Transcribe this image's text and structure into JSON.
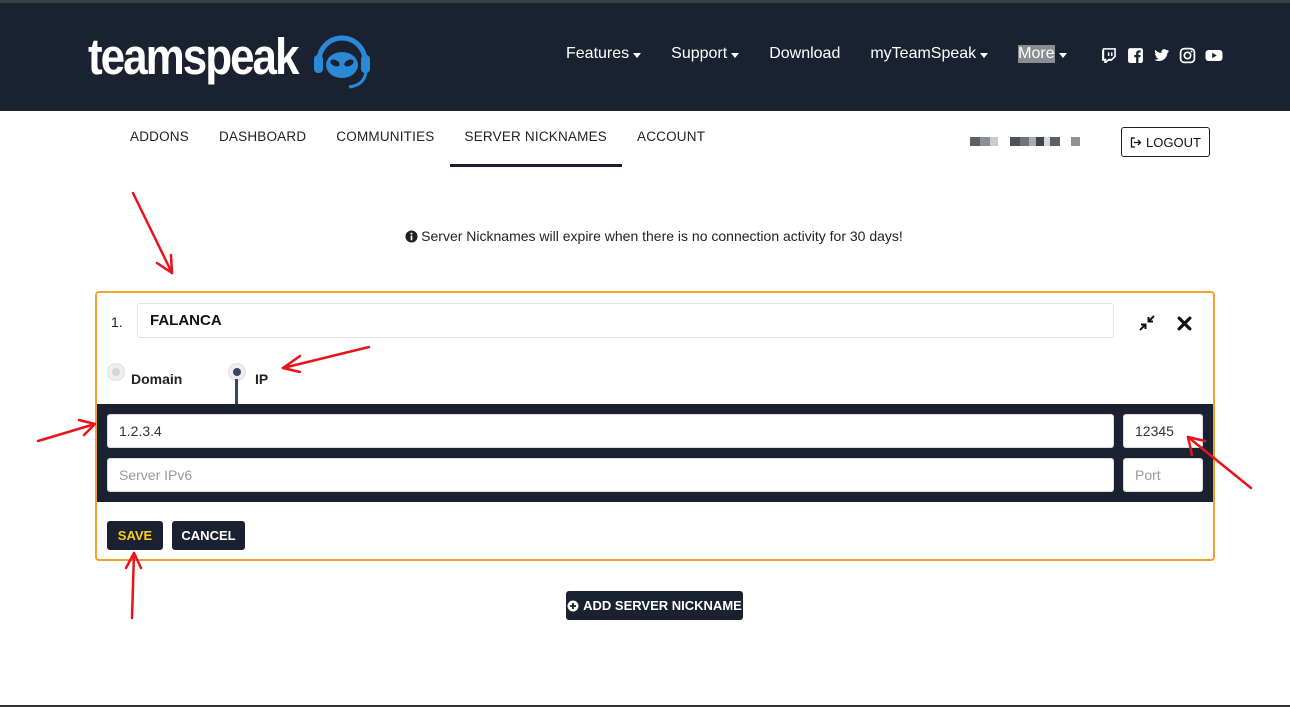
{
  "header": {
    "logo_text": "teamspeak",
    "nav": [
      {
        "label": "Features",
        "dropdown": true
      },
      {
        "label": "Support",
        "dropdown": true
      },
      {
        "label": "Download",
        "dropdown": false
      },
      {
        "label": "myTeamSpeak",
        "dropdown": true
      },
      {
        "label": "More",
        "dropdown": true
      }
    ],
    "social_icons": [
      "twitch-icon",
      "facebook-icon",
      "twitter-icon",
      "instagram-icon",
      "youtube-icon"
    ]
  },
  "subnav": {
    "items": [
      {
        "label": "ADDONS"
      },
      {
        "label": "DASHBOARD"
      },
      {
        "label": "COMMUNITIES"
      },
      {
        "label": "SERVER NICKNAMES",
        "active": true
      },
      {
        "label": "ACCOUNT"
      }
    ],
    "logout_label": "LOGOUT"
  },
  "info_text": "Server Nicknames will expire when there is no connection activity for 30 days!",
  "card": {
    "index": "1.",
    "nickname": "FALANCA",
    "radio_domain_label": "Domain",
    "radio_ip_label": "IP",
    "selected": "IP",
    "ipv4_value": "1.2.3.4",
    "port_value": "12345",
    "ipv6_placeholder": "Server IPv6",
    "port2_placeholder": "Port",
    "save_label": "SAVE",
    "cancel_label": "CANCEL"
  },
  "add_button_label": "ADD SERVER NICKNAME",
  "colors": {
    "navbar": "#1a2130",
    "card_border": "#f0a030",
    "save_text": "#f5d020",
    "annotation_arrow": "#e8141b"
  }
}
